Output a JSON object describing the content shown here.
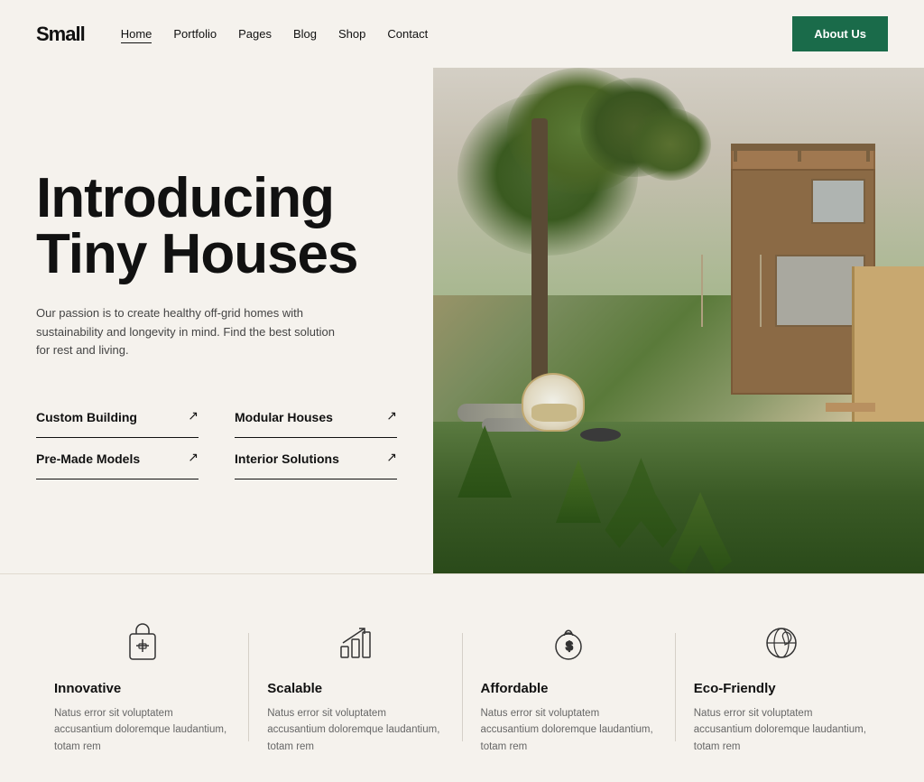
{
  "logo": {
    "text": "Small"
  },
  "nav": {
    "links": [
      {
        "label": "Home",
        "active": true
      },
      {
        "label": "Portfolio",
        "active": false
      },
      {
        "label": "Pages",
        "active": false
      },
      {
        "label": "Blog",
        "active": false
      },
      {
        "label": "Shop",
        "active": false
      },
      {
        "label": "Contact",
        "active": false
      }
    ],
    "cta": "About Us"
  },
  "hero": {
    "title": "Introducing Tiny Houses",
    "description": "Our passion is to create healthy off-grid homes with sustainability and longevity in mind. Find the best solution for rest and living.",
    "links": [
      {
        "label": "Custom Building",
        "arrow": "↗"
      },
      {
        "label": "Modular Houses",
        "arrow": "↗"
      },
      {
        "label": "Pre-Made Models",
        "arrow": "↗"
      },
      {
        "label": "Interior Solutions",
        "arrow": "↗"
      }
    ]
  },
  "features": [
    {
      "icon": "innovative-icon",
      "title": "Innovative",
      "description": "Natus error sit voluptatem accusantium doloremque laudantium, totam rem"
    },
    {
      "icon": "scalable-icon",
      "title": "Scalable",
      "description": "Natus error sit voluptatem accusantium doloremque laudantium, totam rem"
    },
    {
      "icon": "affordable-icon",
      "title": "Affordable",
      "description": "Natus error sit voluptatem accusantium doloremque laudantium, totam rem"
    },
    {
      "icon": "eco-friendly-icon",
      "title": "Eco-Friendly",
      "description": "Natus error sit voluptatem accusantium doloremque laudantium, totam rem"
    }
  ]
}
